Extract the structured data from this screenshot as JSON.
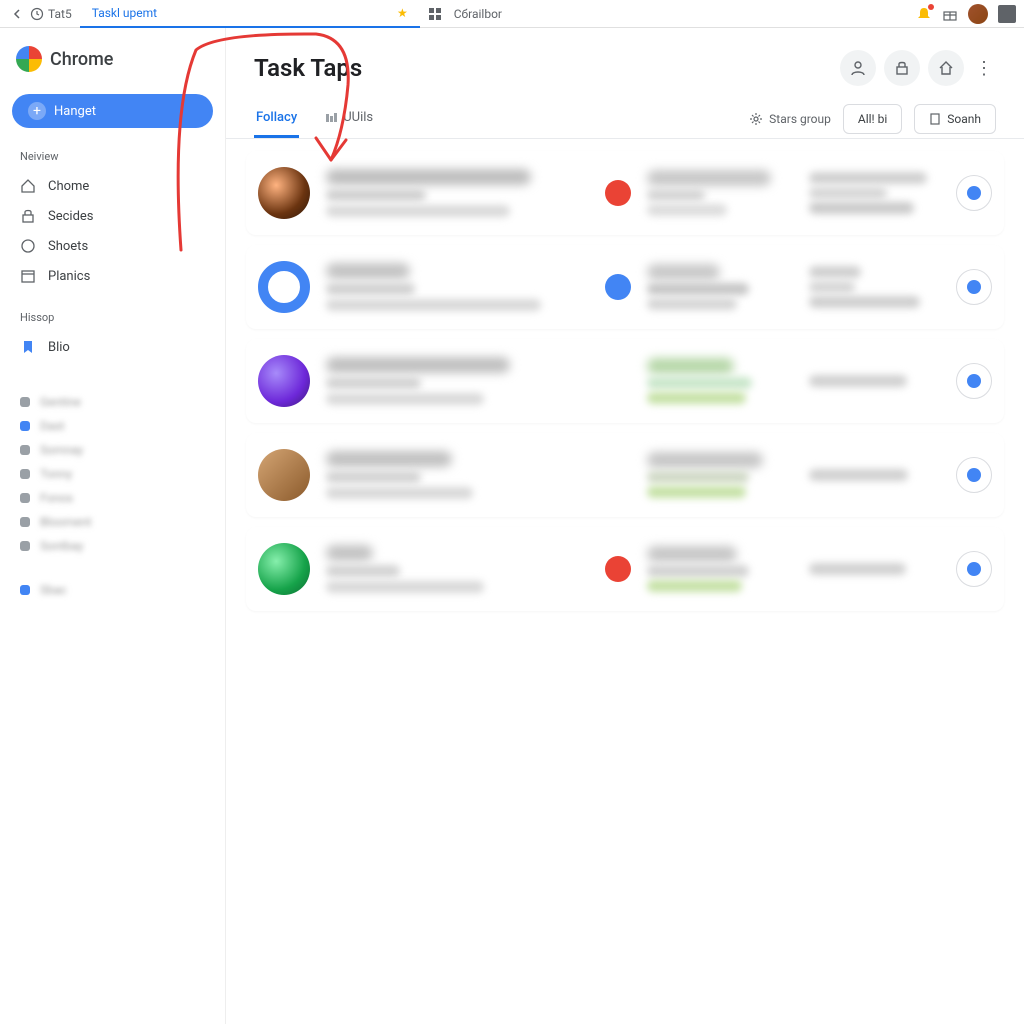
{
  "browser": {
    "back_tab": "Tat5",
    "active_tab": "Taskl upemt",
    "collab": "Cбrailbor"
  },
  "sidebar": {
    "brand": "Chrome",
    "primary": "Hanget",
    "sections": [
      {
        "heading": "Neiview",
        "items": [
          "Chome",
          "Secides",
          "Shoets",
          "Planics"
        ]
      },
      {
        "heading": "Hissop",
        "items": [
          "Blio"
        ]
      }
    ],
    "filters": [
      {
        "color": "#9aa0a6",
        "label": "Gentine"
      },
      {
        "color": "#4285f4",
        "label": "Dast"
      },
      {
        "color": "#9aa0a6",
        "label": "Somnay"
      },
      {
        "color": "#9aa0a6",
        "label": "Tonny"
      },
      {
        "color": "#9aa0a6",
        "label": "Fonos"
      },
      {
        "color": "#9aa0a6",
        "label": "Blooment"
      },
      {
        "color": "#9aa0a6",
        "label": "Sontbay"
      }
    ],
    "footer_label": "Sbac"
  },
  "header": {
    "title": "Task Taps"
  },
  "tabs": {
    "primary": "Follacy",
    "secondary": "UUils"
  },
  "toolbar": {
    "group_label": "Stars group",
    "btn1": "All! bi",
    "btn2": "Soanh"
  },
  "rows": [
    {
      "avatar_bg": "radial-gradient(circle at 35% 35%, #ffb380, #6b3410 60%, #2d1608)",
      "status_color": "#ea4335"
    },
    {
      "avatar_bg": "#4285f4",
      "avatar_style": "solid-ring",
      "status_color": "#4285f4"
    },
    {
      "avatar_bg": "radial-gradient(circle at 35% 35%, #a78bfa, #6d28d9 60%, #3b1a75)",
      "status_color": null
    },
    {
      "avatar_bg": "linear-gradient(135deg, #d4a574, #8b5a2b)",
      "status_color": null
    },
    {
      "avatar_bg": "radial-gradient(circle at 35% 35%, #86efac, #16a34a 60%, #0d6b32)",
      "status_color": "#ea4335"
    }
  ]
}
